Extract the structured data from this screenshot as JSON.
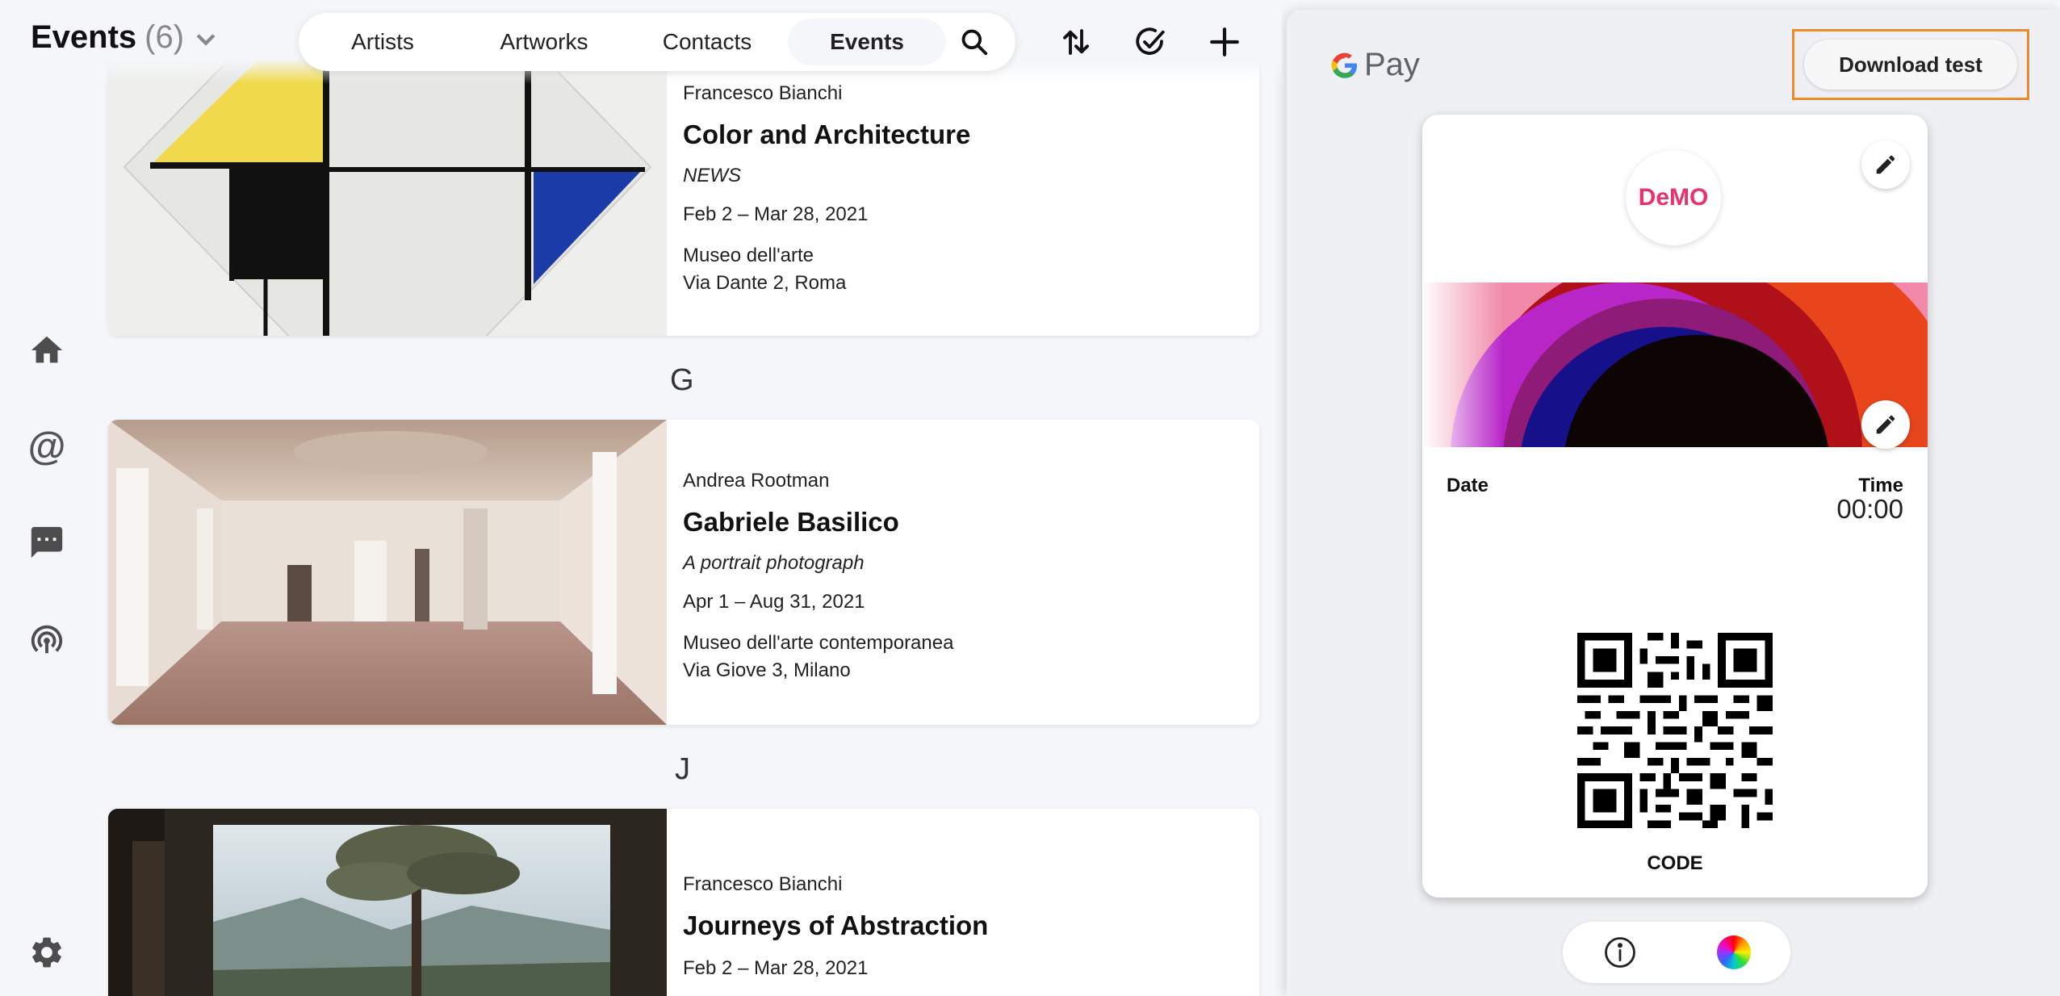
{
  "header": {
    "title": "Events",
    "count": "(6)"
  },
  "nav_tabs": [
    {
      "label": "Artists"
    },
    {
      "label": "Artworks"
    },
    {
      "label": "Contacts"
    },
    {
      "label": "Events",
      "selected": true
    }
  ],
  "toolbar_icons": [
    "search-icon",
    "sort-icon",
    "check-circle-icon",
    "plus-icon"
  ],
  "sidebar_icons": [
    "home-icon",
    "at-sign-icon",
    "chat-icon",
    "broadcast-icon",
    "gear-icon"
  ],
  "sidebar": {
    "at_symbol": "@"
  },
  "events": [
    {
      "artist": "Francesco Bianchi",
      "title": "Color and Architecture",
      "subtitle": "NEWS",
      "dates": "Feb 2 – Mar 28, 2021",
      "venue": "Museo dell'arte",
      "address": "Via Dante 2, Roma"
    },
    {
      "section_letter": "G",
      "artist": "Andrea Rootman",
      "title": "Gabriele Basilico",
      "subtitle": "A portrait photograph",
      "dates": "Apr 1 – Aug 31, 2021",
      "venue": "Museo dell'arte contemporanea",
      "address": "Via Giove 3, Milano"
    },
    {
      "section_letter": "J",
      "artist": "Francesco Bianchi",
      "title": "Journeys of Abstraction",
      "dates": "Feb 2 – Mar 28, 2021"
    }
  ],
  "panel": {
    "brand": "Pay",
    "download_label": "Download test",
    "pass": {
      "logo_text": "DeMO",
      "date_label": "Date",
      "time_label": "Time",
      "time_value": "00:00",
      "code_label": "CODE"
    },
    "bottom_icons": [
      "info-icon",
      "color-wheel-icon"
    ]
  },
  "colors": {
    "background": "#f4f6f9",
    "highlight_border": "#f0882e",
    "logo_pink": "#e8336d"
  }
}
